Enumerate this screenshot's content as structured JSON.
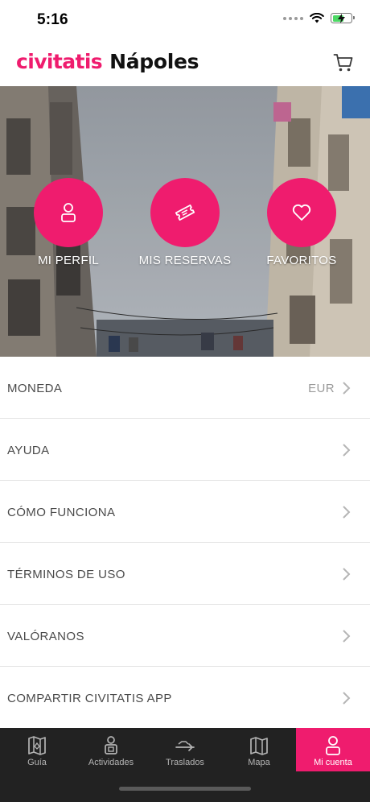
{
  "status_bar": {
    "time": "5:16"
  },
  "header": {
    "brand": "civitatis",
    "city": "Nápoles"
  },
  "hero_actions": [
    {
      "label": "MI PERFIL",
      "icon": "user-icon"
    },
    {
      "label": "MIS RESERVAS",
      "icon": "ticket-icon"
    },
    {
      "label": "FAVORITOS",
      "icon": "heart-icon"
    }
  ],
  "menu": [
    {
      "label": "MONEDA",
      "value": "EUR"
    },
    {
      "label": "AYUDA"
    },
    {
      "label": "CÓMO FUNCIONA"
    },
    {
      "label": "TÉRMINOS DE USO"
    },
    {
      "label": "VALÓRANOS"
    },
    {
      "label": "COMPARTIR CIVITATIS APP"
    }
  ],
  "tabs": [
    {
      "label": "Guía",
      "icon": "map-guide-icon"
    },
    {
      "label": "Actividades",
      "icon": "activities-icon"
    },
    {
      "label": "Traslados",
      "icon": "transfer-plane-icon"
    },
    {
      "label": "Mapa",
      "icon": "map-icon"
    },
    {
      "label": "Mi cuenta",
      "icon": "user-icon",
      "active": true
    }
  ],
  "colors": {
    "accent": "#ef1c6e",
    "tab_bar": "#222222",
    "divider": "#e3e3e3"
  }
}
